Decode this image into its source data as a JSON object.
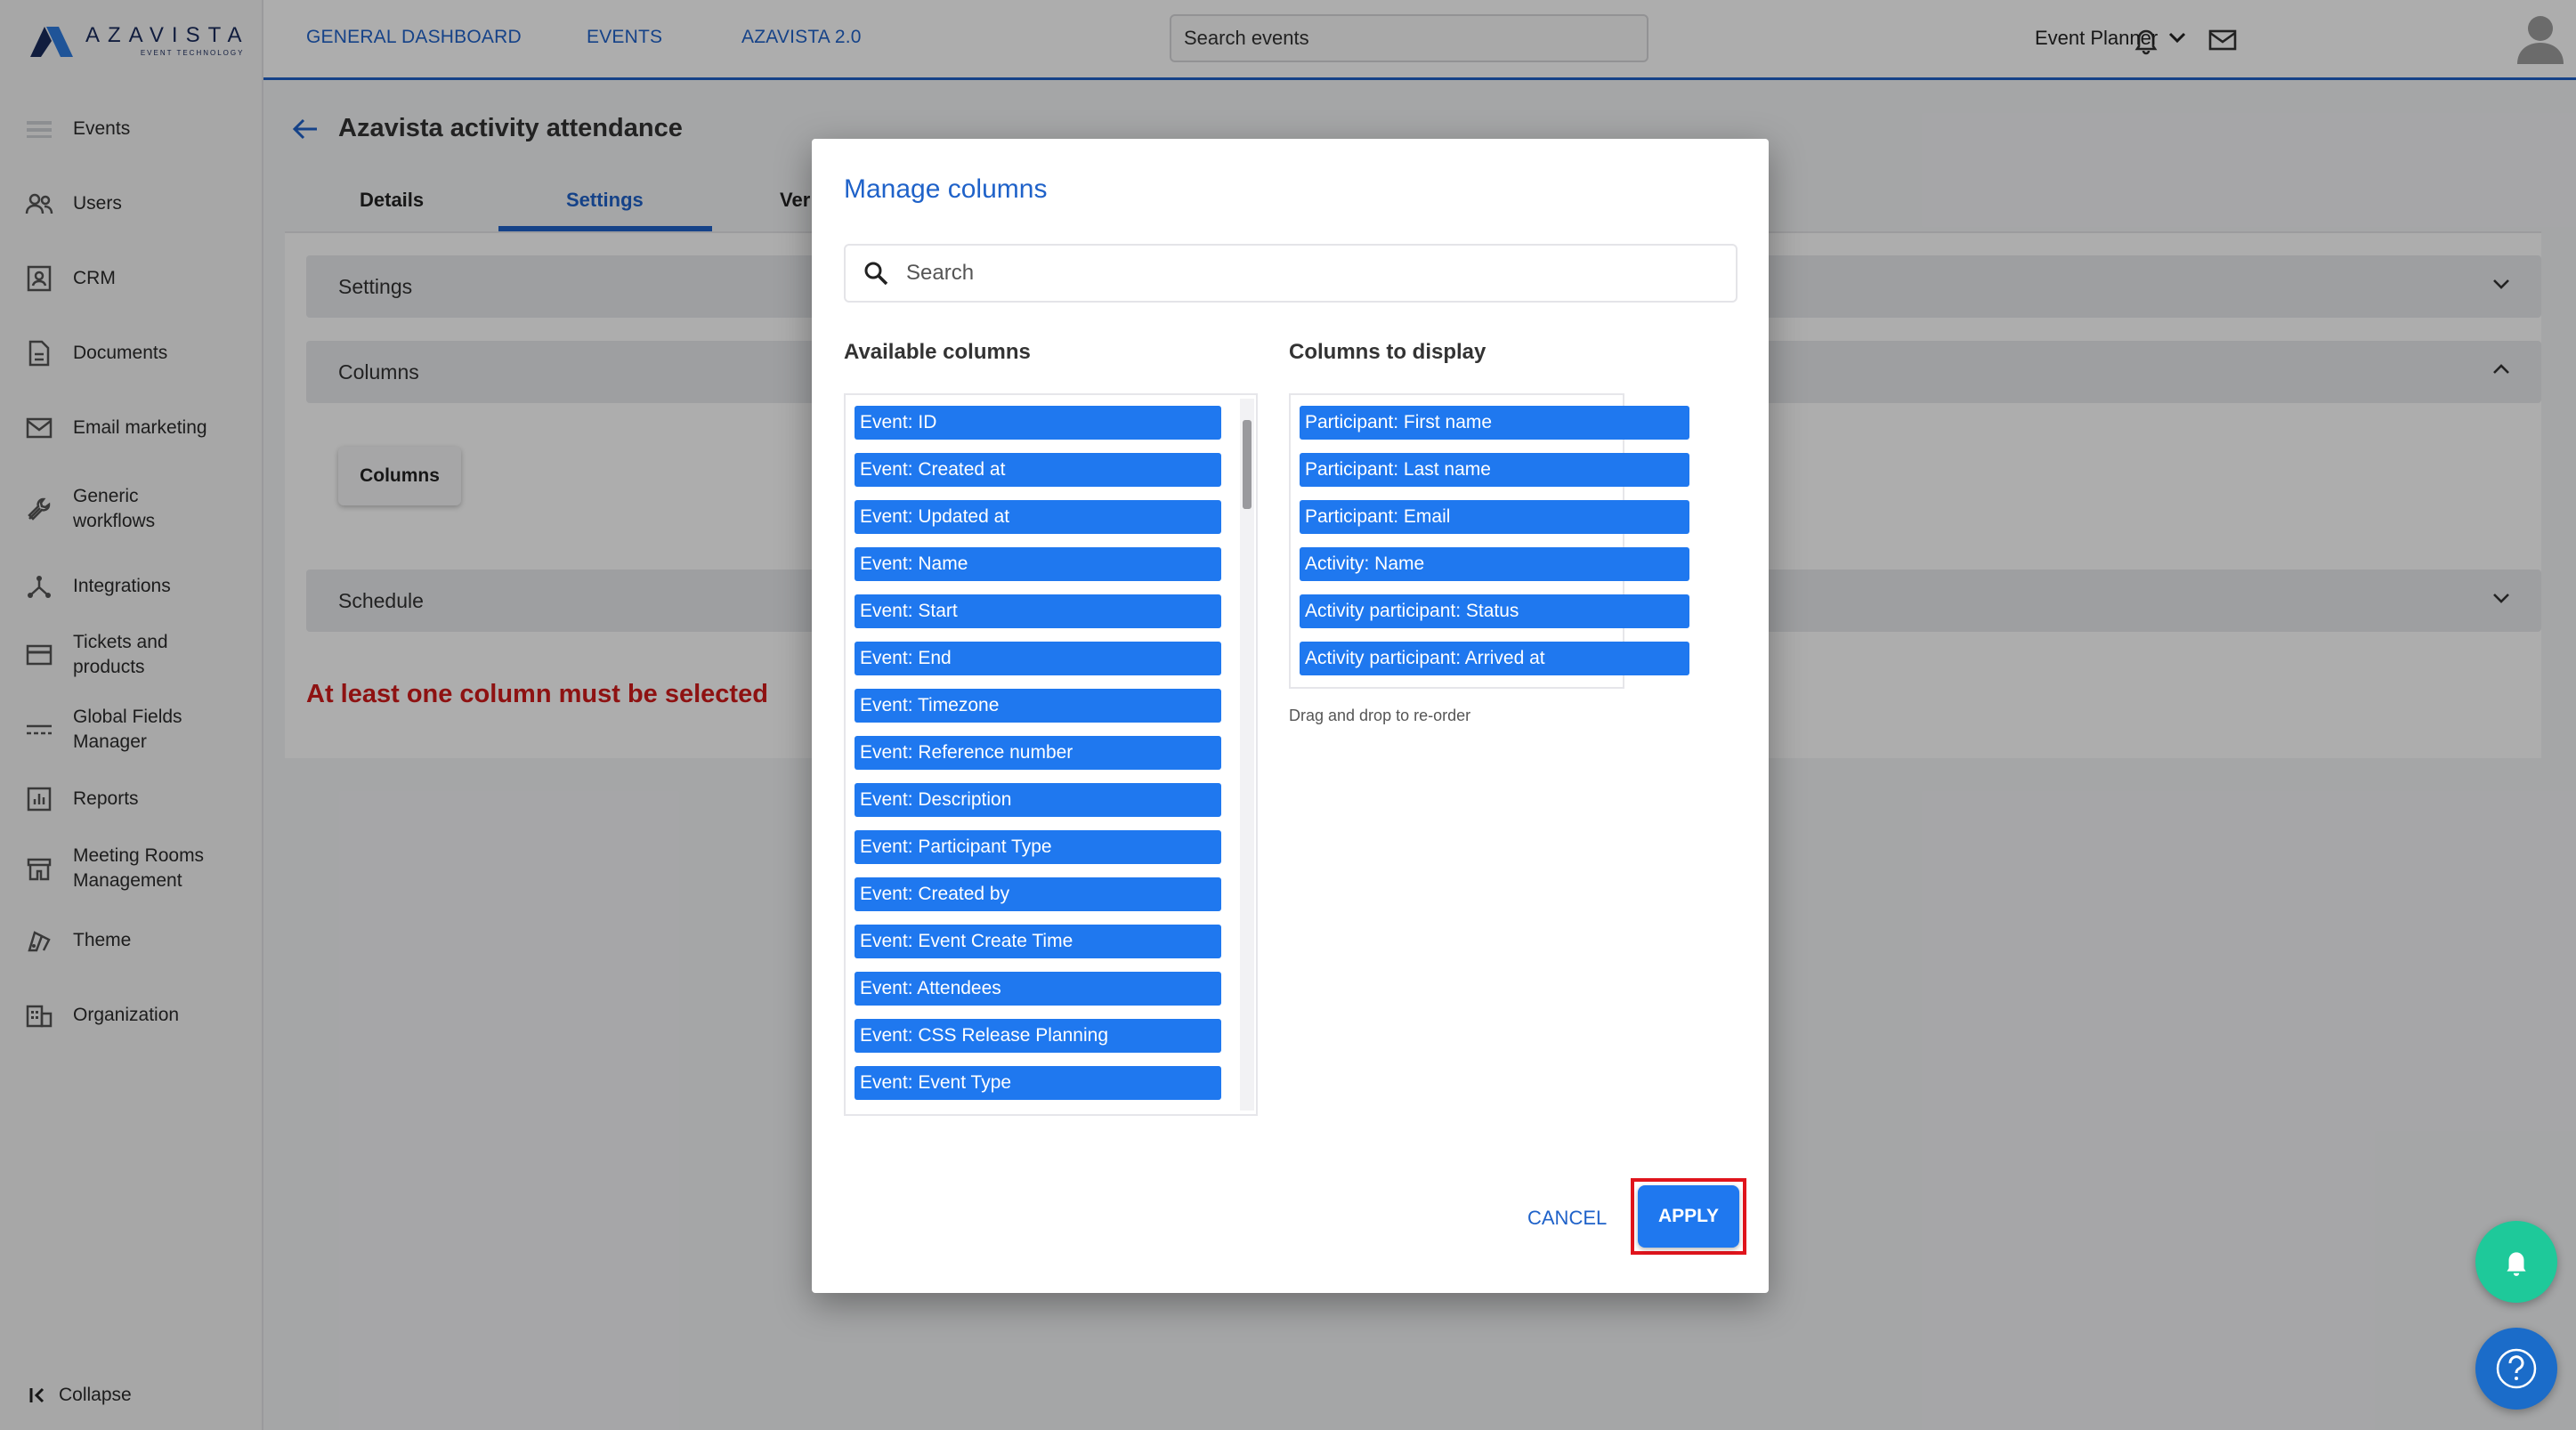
{
  "brand": {
    "name": "AZAVISTA",
    "tagline": "EVENT TECHNOLOGY"
  },
  "sidebar": {
    "items": [
      {
        "label": "Events",
        "icon": "events-icon"
      },
      {
        "label": "Users",
        "icon": "users-icon"
      },
      {
        "label": "CRM",
        "icon": "crm-icon"
      },
      {
        "label": "Documents",
        "icon": "documents-icon"
      },
      {
        "label": "Email marketing",
        "icon": "email-icon"
      },
      {
        "label": "Generic\nworkflows",
        "icon": "wrench-icon"
      },
      {
        "label": "Integrations",
        "icon": "integrations-icon"
      },
      {
        "label": "Tickets and\nproducts",
        "icon": "card-icon"
      },
      {
        "label": "Global Fields\nManager",
        "icon": "fields-icon"
      },
      {
        "label": "Reports",
        "icon": "reports-icon"
      },
      {
        "label": "Meeting Rooms\nManagement",
        "icon": "rooms-icon"
      },
      {
        "label": "Theme",
        "icon": "theme-icon"
      },
      {
        "label": "Organization",
        "icon": "organization-icon"
      }
    ],
    "collapse_label": "Collapse"
  },
  "topbar": {
    "links": [
      "GENERAL DASHBOARD",
      "EVENTS",
      "AZAVISTA 2.0"
    ],
    "search_placeholder": "Search events",
    "user_role": "Event Planner"
  },
  "page": {
    "title": "Azavista activity attendance",
    "tabs": [
      "Details",
      "Settings",
      "Ver"
    ],
    "active_tab": "Settings",
    "panels": [
      "Settings",
      "Columns",
      "Schedule"
    ],
    "columns_button": "Columns",
    "error": "At least one column must be selected"
  },
  "modal": {
    "title": "Manage columns",
    "search_placeholder": "Search",
    "available_heading": "Available columns",
    "display_heading": "Columns to display",
    "available": [
      "Event: ID",
      "Event: Created at",
      "Event: Updated at",
      "Event: Name",
      "Event: Start",
      "Event: End",
      "Event: Timezone",
      "Event: Reference number",
      "Event: Description",
      "Event: Participant Type",
      "Event: Created by",
      "Event: Event Create Time",
      "Event: Attendees",
      "Event: CSS Release Planning",
      "Event: Event Type"
    ],
    "display": [
      "Participant: First name",
      "Participant: Last name",
      "Participant: Email",
      "Activity: Name",
      "Activity participant: Status",
      "Activity participant: Arrived at"
    ],
    "hint": "Drag and drop to re-order",
    "cancel": "CANCEL",
    "apply": "APPLY"
  },
  "colors": {
    "primary": "#1f62c9",
    "chip": "#1f78ef",
    "error": "#d11b1b",
    "highlight": "#e0141c",
    "fab_green": "#1ec99a"
  }
}
